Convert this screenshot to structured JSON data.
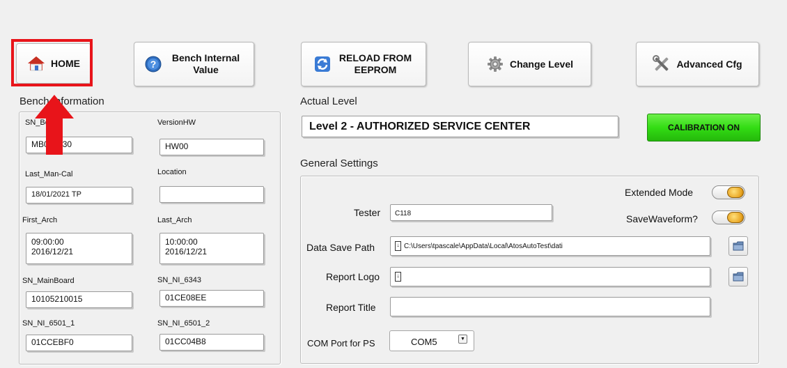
{
  "toolbar": {
    "home": "HOME",
    "bench_internal_value": "Bench Internal Value",
    "reload_from_eeprom": "RELOAD FROM EEPROM",
    "change_level": "Change Level",
    "advanced_cfg": "Advanced Cfg"
  },
  "bench_info": {
    "title": "Bench Information",
    "fields": {
      "sn": {
        "label": "SN_Bench",
        "value": "MB000030"
      },
      "version_hw": {
        "label": "VersionHW",
        "value": "HW00"
      },
      "last_man_cal": {
        "label": "Last_Man-Cal",
        "value": "18/01/2021 TP"
      },
      "location": {
        "label": "Location",
        "value": ""
      },
      "first_arch": {
        "label": "First_Arch",
        "value": "09:00:00\n2016/12/21"
      },
      "last_arch": {
        "label": "Last_Arch",
        "value": "10:00:00\n2016/12/21"
      },
      "sn_mainboard": {
        "label": "SN_MainBoard",
        "value": "10105210015"
      },
      "sn_ni_6343": {
        "label": "SN_NI_6343",
        "value": "01CE08EE"
      },
      "sn_ni_6501_1": {
        "label": "SN_NI_6501_1",
        "value": "01CCEBF0"
      },
      "sn_ni_6501_2": {
        "label": "SN_NI_6501_2",
        "value": "01CC04B8"
      }
    }
  },
  "actual_level": {
    "title": "Actual Level",
    "value": "Level 2 - AUTHORIZED SERVICE CENTER",
    "calibration_button": "CALIBRATION ON"
  },
  "general_settings": {
    "title": "General Settings",
    "extended_mode": "Extended Mode",
    "save_waveform": "SaveWaveform?",
    "tester": {
      "label": "Tester",
      "value": "C118"
    },
    "data_save_path": {
      "label": "Data Save Path",
      "value": "C:\\Users\\tpascale\\AppData\\Local\\AtosAutoTest\\dati"
    },
    "report_logo": {
      "label": "Report Logo",
      "value": ""
    },
    "report_title": {
      "label": "Report Title",
      "value": ""
    },
    "com_port": {
      "label": "COM Port for PS",
      "value": "COM5"
    }
  },
  "colors": {
    "highlight": "#e8141a",
    "calibration_green": "#33dd14",
    "toggle_knob": "#e8a320"
  }
}
